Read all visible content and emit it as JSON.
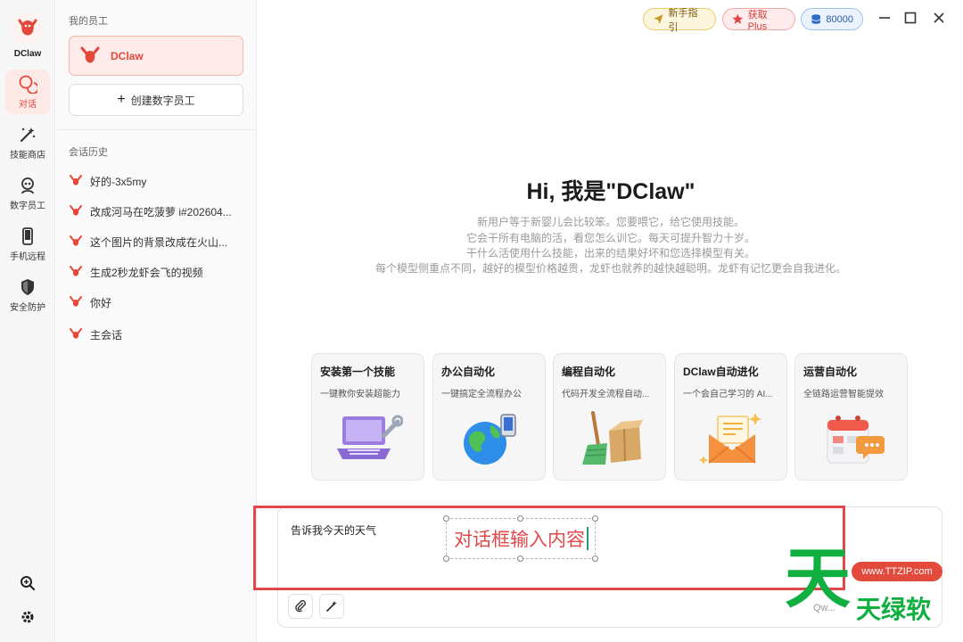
{
  "app": {
    "name": "DClaw"
  },
  "rail": {
    "items": [
      {
        "label": "对话",
        "icon": "chat-icon",
        "active": true
      },
      {
        "label": "技能商店",
        "icon": "magic-wand-icon",
        "active": false
      },
      {
        "label": "数字员工",
        "icon": "robot-icon",
        "active": false
      },
      {
        "label": "手机远程",
        "icon": "phone-icon",
        "active": false
      },
      {
        "label": "安全防护",
        "icon": "shield-icon",
        "active": false
      }
    ],
    "bottom_icons": [
      "zoom-search-icon",
      "gear-icon"
    ]
  },
  "sidebar": {
    "employees_title": "我的员工",
    "employee_name": "DClaw",
    "create_label": "创建数字员工",
    "history_title": "会话历史",
    "history": [
      "好的-3x5my",
      "改成河马在吃菠萝 i#202604...",
      "这个图片的背景改成在火山...",
      "生成2秒龙虾会飞的视频",
      "你好",
      "主会话"
    ]
  },
  "topbar": {
    "guide_label": "新手指引",
    "plus_label": "获取Plus",
    "coins": "80000"
  },
  "hero": {
    "title": "Hi, 我是\"DClaw\"",
    "lines": [
      "新用户等于新婴儿会比较笨。您要喂它，给它使用技能。",
      "它会干所有电脑的活，看您怎么训它。每天可提升智力十岁。",
      "干什么活使用什么技能，出来的结果好坏和您选择模型有关。",
      "每个模型侧重点不同，越好的模型价格越贵，龙虾也就养的越快越聪明。龙虾有记忆更会自我进化。"
    ]
  },
  "cards": [
    {
      "title": "安装第一个技能",
      "subtitle": "一键教你安装超能力",
      "icon": "laptop-wrench-icon"
    },
    {
      "title": "办公自动化",
      "subtitle": "一键搞定全流程办公",
      "icon": "globe-phone-icon"
    },
    {
      "title": "编程自动化",
      "subtitle": "代码开发全流程自动...",
      "icon": "broom-box-icon"
    },
    {
      "title": "DClaw自动进化",
      "subtitle": "一个会自己学习的 AI...",
      "icon": "envelope-icon"
    },
    {
      "title": "运营自动化",
      "subtitle": "全链路运营智能提效",
      "icon": "calendar-chat-icon"
    }
  ],
  "input": {
    "value": "告诉我今天的天气",
    "annotation": "对话框输入内容",
    "model_label": "Qw..."
  },
  "watermark": {
    "big": "天",
    "url": "www.TTZIP.com",
    "small": "天绿软"
  },
  "colors": {
    "accent": "#e4483a",
    "highlight": "#e0484c",
    "watermark_green": "#0fb040"
  }
}
